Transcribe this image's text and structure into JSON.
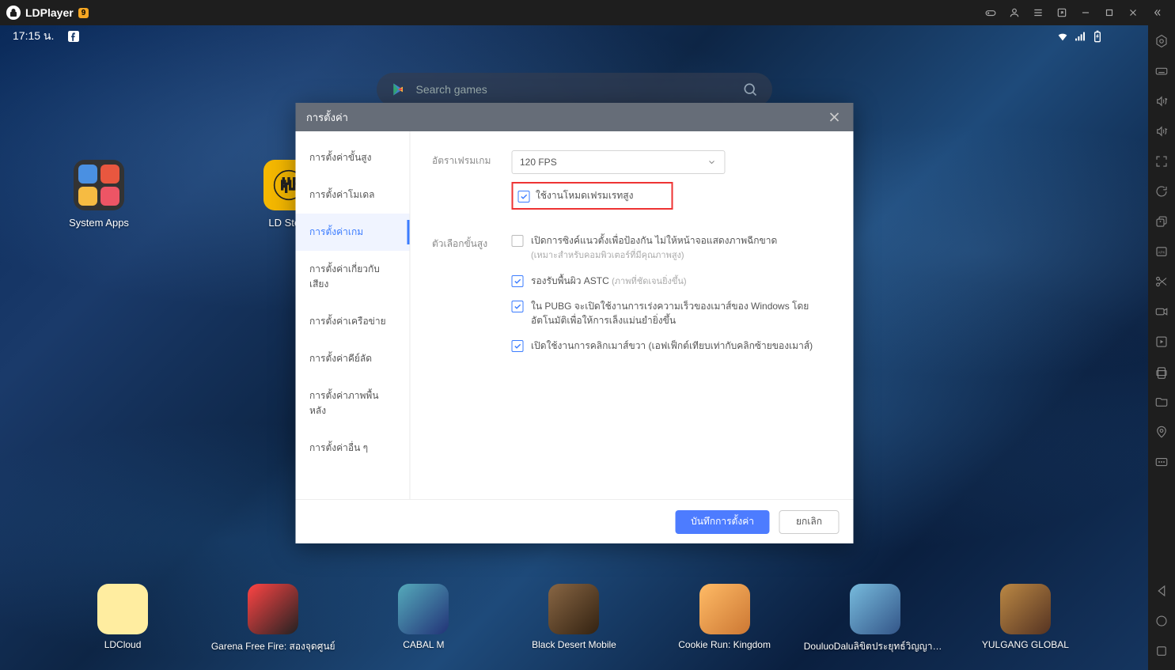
{
  "titlebar": {
    "brand": "LDPlayer",
    "badge": "9"
  },
  "statusbar": {
    "time": "17:15 น."
  },
  "search": {
    "placeholder": "Search games"
  },
  "desktop": {
    "system_apps": "System Apps",
    "ld_store": "LD Store"
  },
  "taskbar": [
    {
      "label": "LDCloud",
      "class": "ldcloud"
    },
    {
      "label": "Garena Free Fire: สองจุดศูนย์",
      "class": "freefire"
    },
    {
      "label": "CABAL M",
      "class": "cabal"
    },
    {
      "label": "Black Desert Mobile",
      "class": "bdm"
    },
    {
      "label": "Cookie Run: Kingdom",
      "class": "cookie"
    },
    {
      "label": "DouluoDaluลิขิตประยุทธ์วิญญาณาจารย์",
      "class": "douluo"
    },
    {
      "label": "YULGANG GLOBAL",
      "class": "yulgang"
    }
  ],
  "modal": {
    "title": "การตั้งค่า",
    "sidebar": [
      "การตั้งค่าขั้นสูง",
      "การตั้งค่าโมเดล",
      "การตั้งค่าเกม",
      "การตั้งค่าเกี่ยวกับเสียง",
      "การตั้งค่าเครือข่าย",
      "การตั้งค่าคีย์ลัด",
      "การตั้งค่าภาพพื้นหลัง",
      "การตั้งค่าอื่น ๆ"
    ],
    "content": {
      "framerate_label": "อัตราเฟรมเกม",
      "framerate_value": "120 FPS",
      "high_fps_checkbox": "ใช้งานโหมดเฟรมเรทสูง",
      "advanced_label": "ตัวเลือกขั้นสูง",
      "opt_vertical": "เปิดการซิงค์แนวตั้งเพื่อป้องกัน ไม่ให้หน้าจอแสดงภาพฉีกขาด",
      "opt_vertical_sub": "(เหมาะสำหรับคอมพิวเตอร์ที่มีคุณภาพสูง)",
      "opt_astc": "รองรับพื้นผิว ASTC",
      "opt_astc_sub": "(ภาพที่ชัดเจนยิ่งขึ้น)",
      "opt_pubg": "ใน PUBG จะเปิดใช้งานการเร่งความเร็วของเมาส์ของ Windows โดยอัตโนมัติเพื่อให้การเล็งแม่นยำยิ่งขึ้น",
      "opt_rightclick": "เปิดใช้งานการคลิกเมาส์ขวา (เอฟเฟ็กต์เทียบเท่ากับคลิกซ้ายของเมาส์)"
    },
    "footer": {
      "save": "บันทึกการตั้งค่า",
      "cancel": "ยกเลิก"
    }
  }
}
